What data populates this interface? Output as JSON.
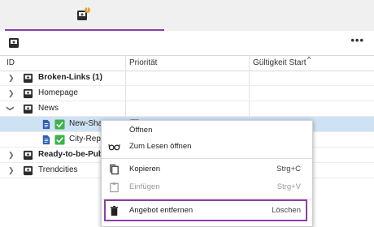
{
  "tab": {
    "badge": "!"
  },
  "toolbar": {
    "more": "•••"
  },
  "columns": {
    "id": "ID",
    "priority": "Priorität",
    "validity_start": "Gültigkeit Start",
    "sort_indicator": "^"
  },
  "rows": [
    {
      "label": "Broken-Links (1)",
      "bold": true,
      "expanded": false,
      "type": "folder"
    },
    {
      "label": "Homepage",
      "bold": false,
      "expanded": false,
      "type": "folder"
    },
    {
      "label": "News",
      "bold": false,
      "expanded": true,
      "type": "folder"
    },
    {
      "label": "New-Sha",
      "bold": false,
      "type": "document-checked",
      "selected": true
    },
    {
      "label": "City-Repo",
      "bold": false,
      "type": "document-checked"
    },
    {
      "label": "Ready-to-be-Publi",
      "bold": true,
      "expanded": false,
      "type": "folder"
    },
    {
      "label": "Trendcities",
      "bold": false,
      "expanded": false,
      "type": "folder"
    }
  ],
  "context_menu": {
    "items": [
      {
        "label": "Öffnen",
        "shortcut": "",
        "icon": "none"
      },
      {
        "label": "Zum Lesen öffnen",
        "shortcut": "",
        "icon": "glasses-icon"
      },
      {
        "label": "Kopieren",
        "shortcut": "Strg+C",
        "icon": "copy-icon"
      },
      {
        "label": "Einfügen",
        "shortcut": "Strg+V",
        "icon": "paste-icon",
        "disabled": true
      },
      {
        "label": "Angebot entfernen",
        "shortcut": "Löschen",
        "icon": "trash-icon",
        "highlighted": true
      }
    ]
  },
  "colors": {
    "accent": "#8a3fa6",
    "selection": "#cfe2f4",
    "check": "#3cb34a",
    "doc": "#2f5fb3"
  }
}
